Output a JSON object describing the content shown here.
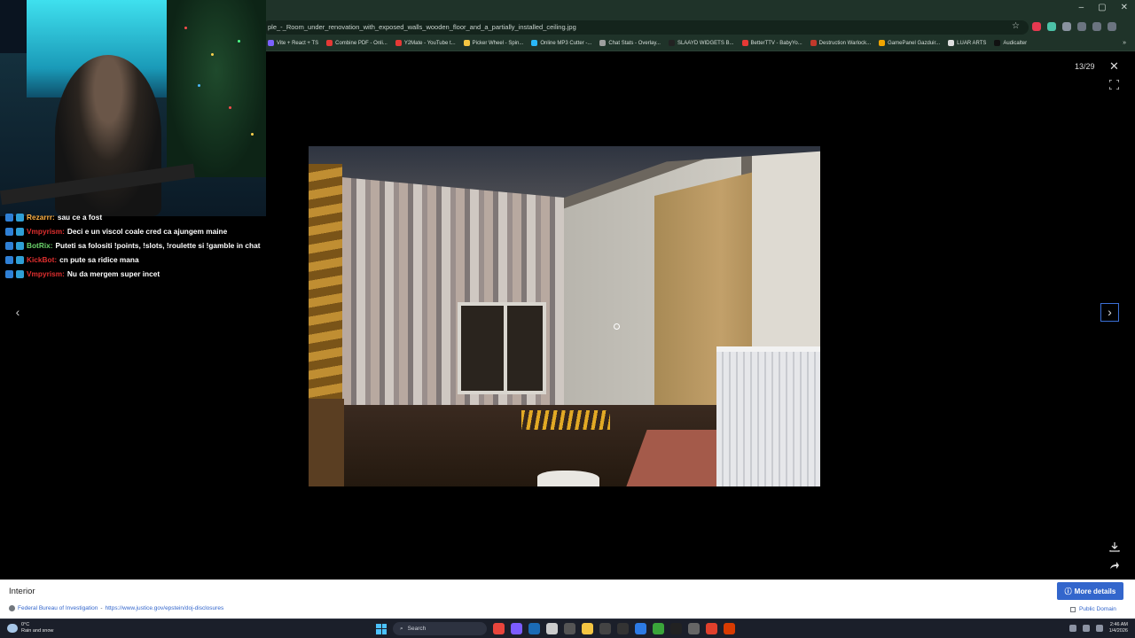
{
  "browser": {
    "url": "ple_-_Room_under_renovation_with_exposed_walls_wooden_floor_and_a_partially_installed_ceiling.jpg",
    "bookmarks": [
      {
        "label": "Vite + React + TS",
        "color": "#7b61ff"
      },
      {
        "label": "Combine PDF - Onli...",
        "color": "#e53935"
      },
      {
        "label": "Y2Mate - YouTube t...",
        "color": "#e53935"
      },
      {
        "label": "Picker Wheel - Spin...",
        "color": "#f4c542"
      },
      {
        "label": "Online MP3 Cutter -...",
        "color": "#29b6f6"
      },
      {
        "label": "Chat Stats - Overlay...",
        "color": "#9e9e9e"
      },
      {
        "label": "SLAAYD WIDGETS B...",
        "color": "#222222"
      },
      {
        "label": "BetterTTV - BabyYo...",
        "color": "#e53935"
      },
      {
        "label": "Destruction Warlock...",
        "color": "#c0392b"
      },
      {
        "label": "GamePanel Gazduir...",
        "color": "#f0a500"
      },
      {
        "label": "LUAR ARTS",
        "color": "#dddddd"
      },
      {
        "label": "Audicalter",
        "color": "#111111"
      }
    ]
  },
  "chat": {
    "messages": [
      {
        "user": "Rezarrr:",
        "user_color": "#ffb347",
        "message": "sau ce a fost"
      },
      {
        "user": "Vmpyrism:",
        "user_color": "#e02f2f",
        "message": "Deci e un viscol coale cred ca ajungem maine"
      },
      {
        "user": "BotRix:",
        "user_color": "#6cd46c",
        "message": "Puteti sa folositi !points, !slots, !roulette si !gamble in chat"
      },
      {
        "user": "KickBot:",
        "user_color": "#e02f2f",
        "message": "cn pute sa ridice mana"
      },
      {
        "user": "Vmpyrism:",
        "user_color": "#e02f2f",
        "message": "Nu da mergem super incet"
      }
    ]
  },
  "lightbox": {
    "counter": "13/29",
    "caption": "Interior",
    "more_details_label": "More details",
    "author": "Federal Bureau of Investigation",
    "separator": "-",
    "source_url": "https://www.justice.gov/epstein/doj-disclosures",
    "license": "Public Domain"
  },
  "taskbar": {
    "weather_temp": "0°C",
    "weather_desc": "Rain and snow",
    "search_placeholder": "Search",
    "time": "2:46 AM",
    "date": "1/4/2026"
  },
  "colors": {
    "browser_chrome": "#1f3329",
    "accent": "#3366cc",
    "taskbar": "#1b1f2a"
  }
}
